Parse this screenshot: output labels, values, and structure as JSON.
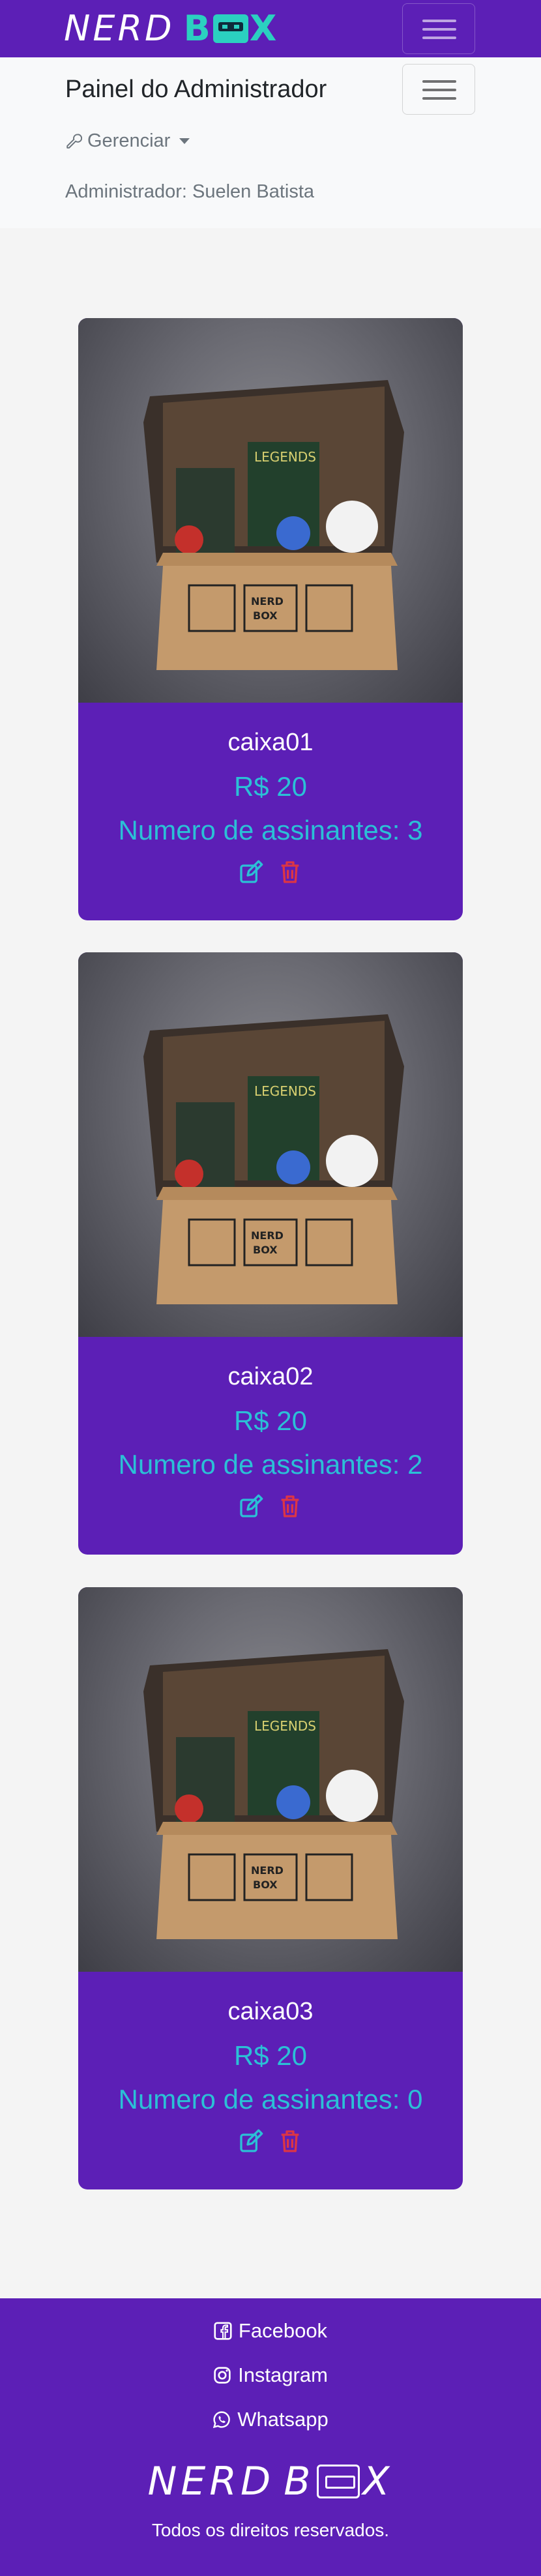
{
  "brand": {
    "logo_left": "NERD",
    "logo_right": "X",
    "logo_mid": "B"
  },
  "admin": {
    "title": "Painel do Administrador",
    "manage_label": "Gerenciar",
    "user_line": "Administrador: Suelen Batista"
  },
  "cards": [
    {
      "name": "caixa01",
      "price": "R$ 20",
      "subscribers": "Numero de assinantes: 3"
    },
    {
      "name": "caixa02",
      "price": "R$ 20",
      "subscribers": "Numero de assinantes: 2"
    },
    {
      "name": "caixa03",
      "price": "R$ 20",
      "subscribers": "Numero de assinantes: 0"
    }
  ],
  "footer": {
    "facebook": "Facebook",
    "instagram": "Instagram",
    "whatsapp": "Whatsapp",
    "rights": "Todos os direitos reservados."
  },
  "colors": {
    "primary": "#5c1fb6",
    "accent": "#2bc0d6",
    "danger": "#dc3545",
    "brand_teal": "#2bd0c0"
  },
  "icons": {
    "edit": "edit-icon",
    "delete": "trash-icon",
    "manage": "wrench-icon",
    "facebook": "facebook-icon",
    "instagram": "instagram-icon",
    "whatsapp": "whatsapp-icon"
  }
}
